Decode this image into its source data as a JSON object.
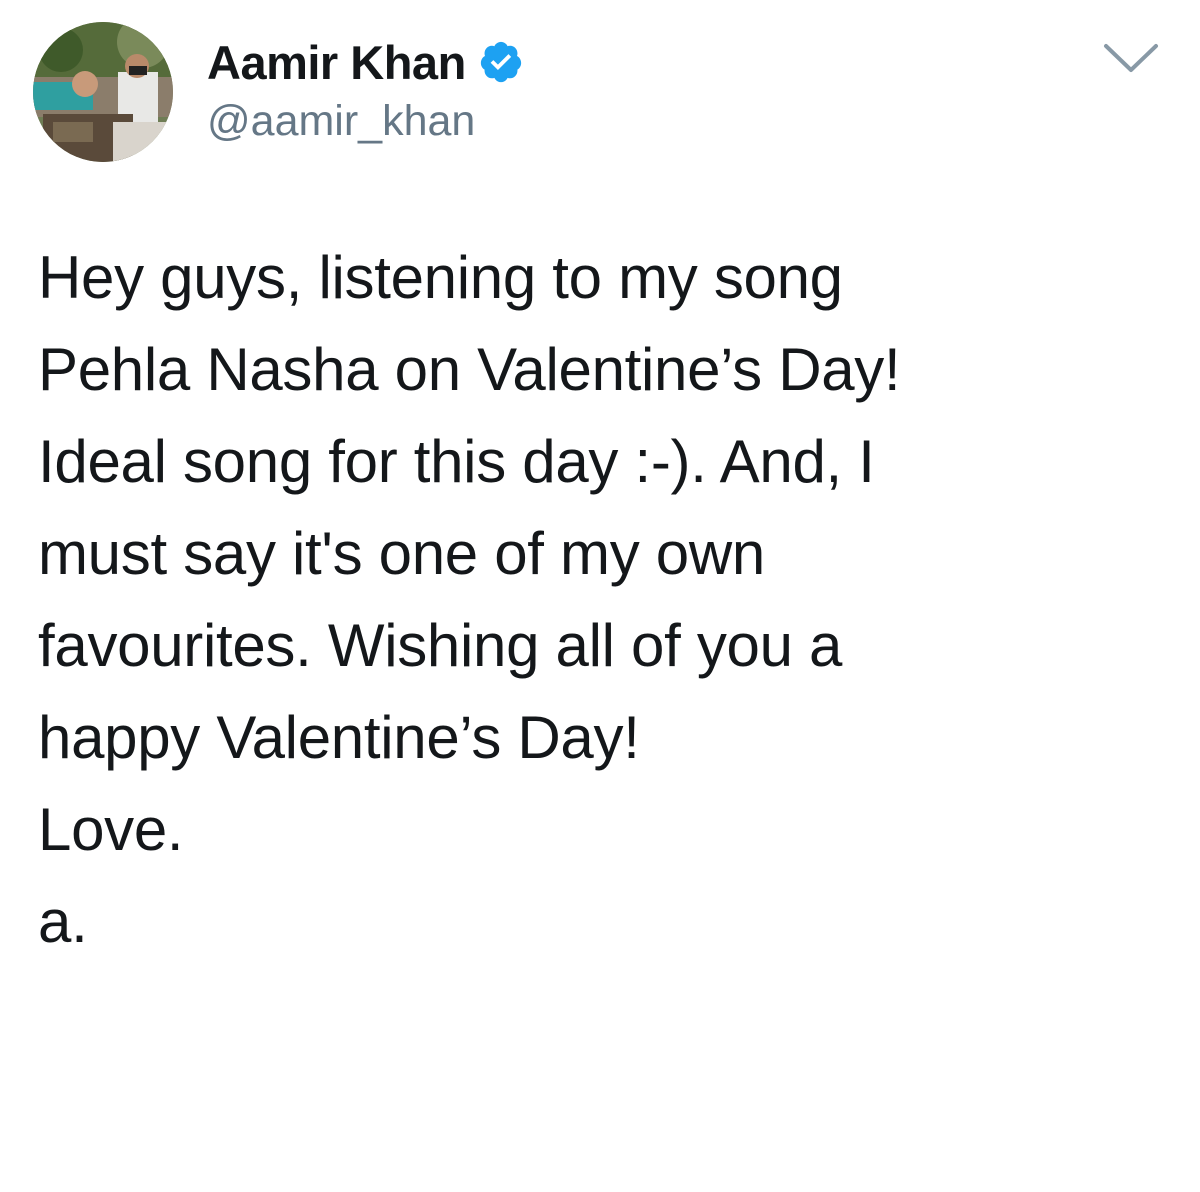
{
  "author": {
    "display_name": "Aamir Khan",
    "handle": "@aamir_khan",
    "verified": true,
    "verified_color": "#1da1f2"
  },
  "menu": {
    "icon": "chevron-down-icon"
  },
  "tweet": {
    "lines": [
      "Hey guys, listening to my song",
      "Pehla Nasha on Valentine’s Day!",
      "Ideal song for this day :-). And, I",
      "must say it's one of my own",
      "favourites. Wishing all of you a",
      "happy Valentine’s Day!",
      "Love.",
      "a."
    ]
  },
  "colors": {
    "text": "#14171a",
    "secondary": "#657786",
    "background": "#ffffff"
  }
}
